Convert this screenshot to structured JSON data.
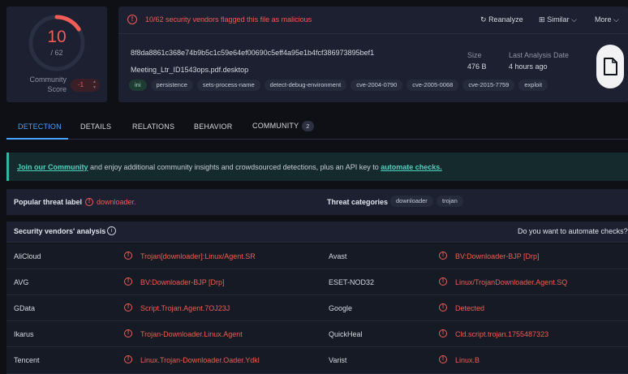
{
  "score": {
    "detections": "10",
    "total": "/ 62",
    "detection_fraction": 0.161,
    "community_label": "Community Score",
    "community_value": "-1",
    "colors": {
      "alert": "#f25c54",
      "ring_track": "#283042"
    }
  },
  "summary": {
    "alert_text": "10/62 security vendors flagged this file as malicious",
    "actions": {
      "reanalyze": "Reanalyze",
      "similar": "Similar",
      "more": "More"
    },
    "hash": "8f8da8861c368e74b9b5c1c59e64ef00690c5eff4a95e1b4fcf386973895bef1",
    "filename": "Meeting_Ltr_ID1543ops.pdf.desktop",
    "tags": [
      "ini",
      "persistence",
      "sets-process-name",
      "detect-debug-environment",
      "cve-2004-0790",
      "cve-2005-0068",
      "cve-2015-7759",
      "exploit"
    ],
    "size_label": "Size",
    "size_value": "476 B",
    "date_label": "Last Analysis Date",
    "date_value": "4 hours ago",
    "file_icon": "document-icon"
  },
  "tabs": {
    "detection": "DETECTION",
    "details": "DETAILS",
    "relations": "RELATIONS",
    "behavior": "BEHAVIOR",
    "community": "COMMUNITY",
    "community_count": "2"
  },
  "banner": {
    "link1": "Join our Community",
    "middle": " and enjoy additional community insights and crowdsourced detections, plus an API key to ",
    "link2": "automate checks."
  },
  "threat": {
    "popular_label": "Popular threat label",
    "popular_value": "downloader.",
    "categories_label": "Threat categories",
    "categories": [
      "downloader",
      "trojan"
    ]
  },
  "vendors": {
    "title": "Security vendors' analysis",
    "automate_prompt": "Do you want to automate checks?",
    "rows": [
      {
        "left_name": "AliCloud",
        "left_result": "Trojan[downloader]:Linux/Agent.SR",
        "right_name": "Avast",
        "right_result": "BV:Downloader-BJP [Drp]"
      },
      {
        "left_name": "AVG",
        "left_result": "BV:Downloader-BJP [Drp]",
        "right_name": "ESET-NOD32",
        "right_result": "Linux/TrojanDownloader.Agent.SQ"
      },
      {
        "left_name": "GData",
        "left_result": "Script.Trojan.Agent.7OJ23J",
        "right_name": "Google",
        "right_result": "Detected"
      },
      {
        "left_name": "Ikarus",
        "left_result": "Trojan-Downloader.Linux.Agent",
        "right_name": "QuickHeal",
        "right_result": "Cld.script.trojan.1755487323"
      },
      {
        "left_name": "Tencent",
        "left_result": "Linux.Trojan-Downloader.Oader.Ydkl",
        "right_name": "Varist",
        "right_result": "Linux.B"
      }
    ]
  }
}
